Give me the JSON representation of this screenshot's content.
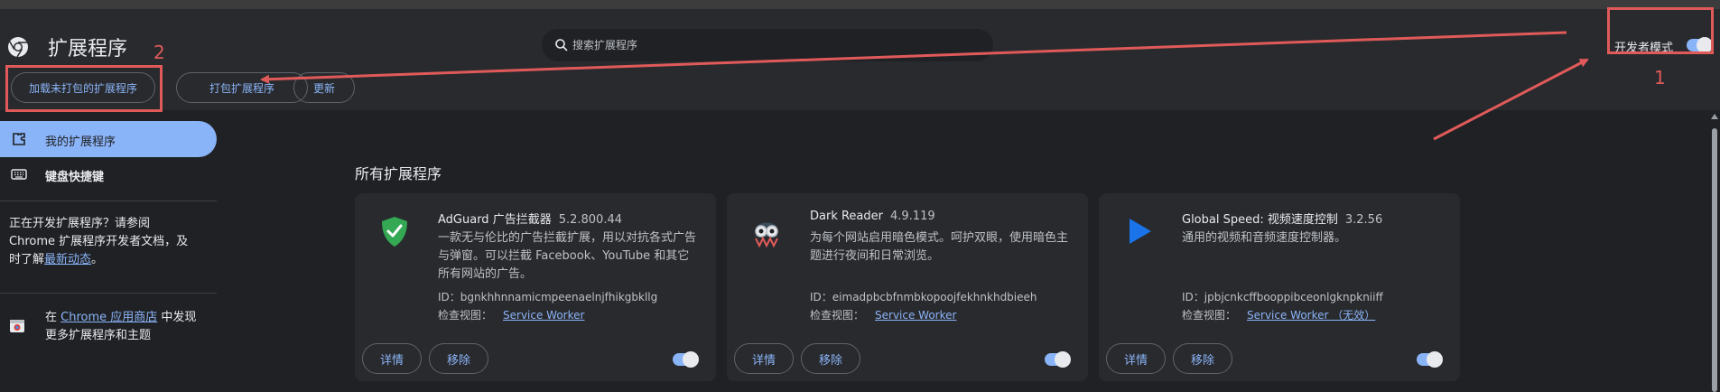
{
  "header": {
    "app_title": "扩展程序",
    "search_placeholder": "搜索扩展程序",
    "developer_mode_label": "开发者模式",
    "developer_mode_on": true
  },
  "toolbar": {
    "load_unpacked_label": "加载未打包的扩展程序",
    "pack_label": "打包扩展程序",
    "update_label": "更新"
  },
  "annotations": {
    "marker_1": "1",
    "marker_2": "2",
    "color": "#e05a5a"
  },
  "sidebar": {
    "items": [
      {
        "label": "我的扩展程序",
        "icon": "puzzle-icon",
        "active": true
      },
      {
        "label": "键盘快捷键",
        "icon": "keyboard-icon",
        "active": false
      }
    ],
    "dev_note_prefix": "正在开发扩展程序？请参阅 Chrome 扩展程序开发者文档，及时了解",
    "dev_note_link": "最新动态",
    "dev_note_suffix": "。",
    "store_prefix": "在",
    "store_link": "Chrome 应用商店",
    "store_suffix": "中发现更多扩展程序和主题"
  },
  "main": {
    "section_title": "所有扩展程序",
    "details_label": "详情",
    "remove_label": "移除",
    "id_prefix": "ID：",
    "inspect_prefix": "检查视图：",
    "extensions": [
      {
        "name": "AdGuard 广告拦截器",
        "version": "5.2.800.44",
        "description": "一款无与伦比的广告拦截扩展，用以对抗各式广告与弹窗。可以拦截 Facebook、YouTube 和其它所有网站的广告。",
        "id": "bgnkhhnnamicmpeenaelnjfhikgbkllg",
        "inspect_link": "Service Worker",
        "icon": "shield-check-icon",
        "enabled": true
      },
      {
        "name": "Dark Reader",
        "version": "4.9.119",
        "description": "为每个网站启用暗色模式。呵护双眼，使用暗色主题进行夜间和日常浏览。",
        "id": "eimadpbcbfnmbkopoojfekhnkhdbieeh",
        "inspect_link": "Service Worker",
        "icon": "dark-reader-icon",
        "enabled": true
      },
      {
        "name": "Global Speed: 视频速度控制",
        "version": "3.2.56",
        "description": "通用的视频和音频速度控制器。",
        "id": "jpbjcnkcffbooppibceonlgknpkniiff",
        "inspect_link": "Service Worker （无效）",
        "icon": "play-triangle-icon",
        "enabled": true
      }
    ]
  },
  "colors": {
    "background": "#202124",
    "surface": "#292a2d",
    "accent": "#8ab4f8",
    "text": "#e8eaed",
    "secondary_text": "#bdc1c6"
  }
}
